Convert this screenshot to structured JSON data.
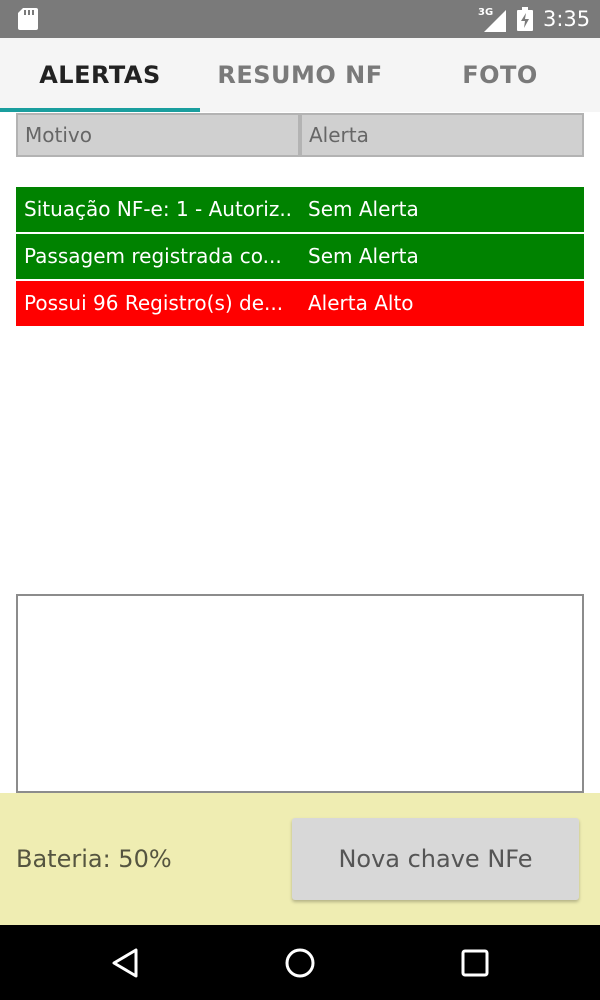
{
  "status_bar": {
    "network_type": "3G",
    "time": "3:35",
    "icons": [
      "sd-card-icon",
      "signal-icon",
      "battery-charging-icon"
    ]
  },
  "tabs": [
    {
      "label": "ALERTAS",
      "active": true
    },
    {
      "label": "RESUMO NF",
      "active": false
    },
    {
      "label": "FOTO",
      "active": false
    }
  ],
  "table": {
    "columns": [
      "Motivo",
      "Alerta"
    ],
    "rows": [
      {
        "motivo": "Situação NF-e: 1 - Autoriz...",
        "alerta": "Sem Alerta",
        "color": "#008200"
      },
      {
        "motivo": "Passagem registrada co...",
        "alerta": "Sem Alerta",
        "color": "#008200"
      },
      {
        "motivo": "Possui 96 Registro(s) de...",
        "alerta": "Alerta Alto",
        "color": "#ff0000"
      }
    ]
  },
  "bottom": {
    "battery_label": "Bateria: 50%",
    "button_label": "Nova chave NFe"
  },
  "colors": {
    "tab_indicator": "#1a9e9e",
    "bottom_panel": "#efedb2",
    "status_bar": "#7a7a7a"
  }
}
